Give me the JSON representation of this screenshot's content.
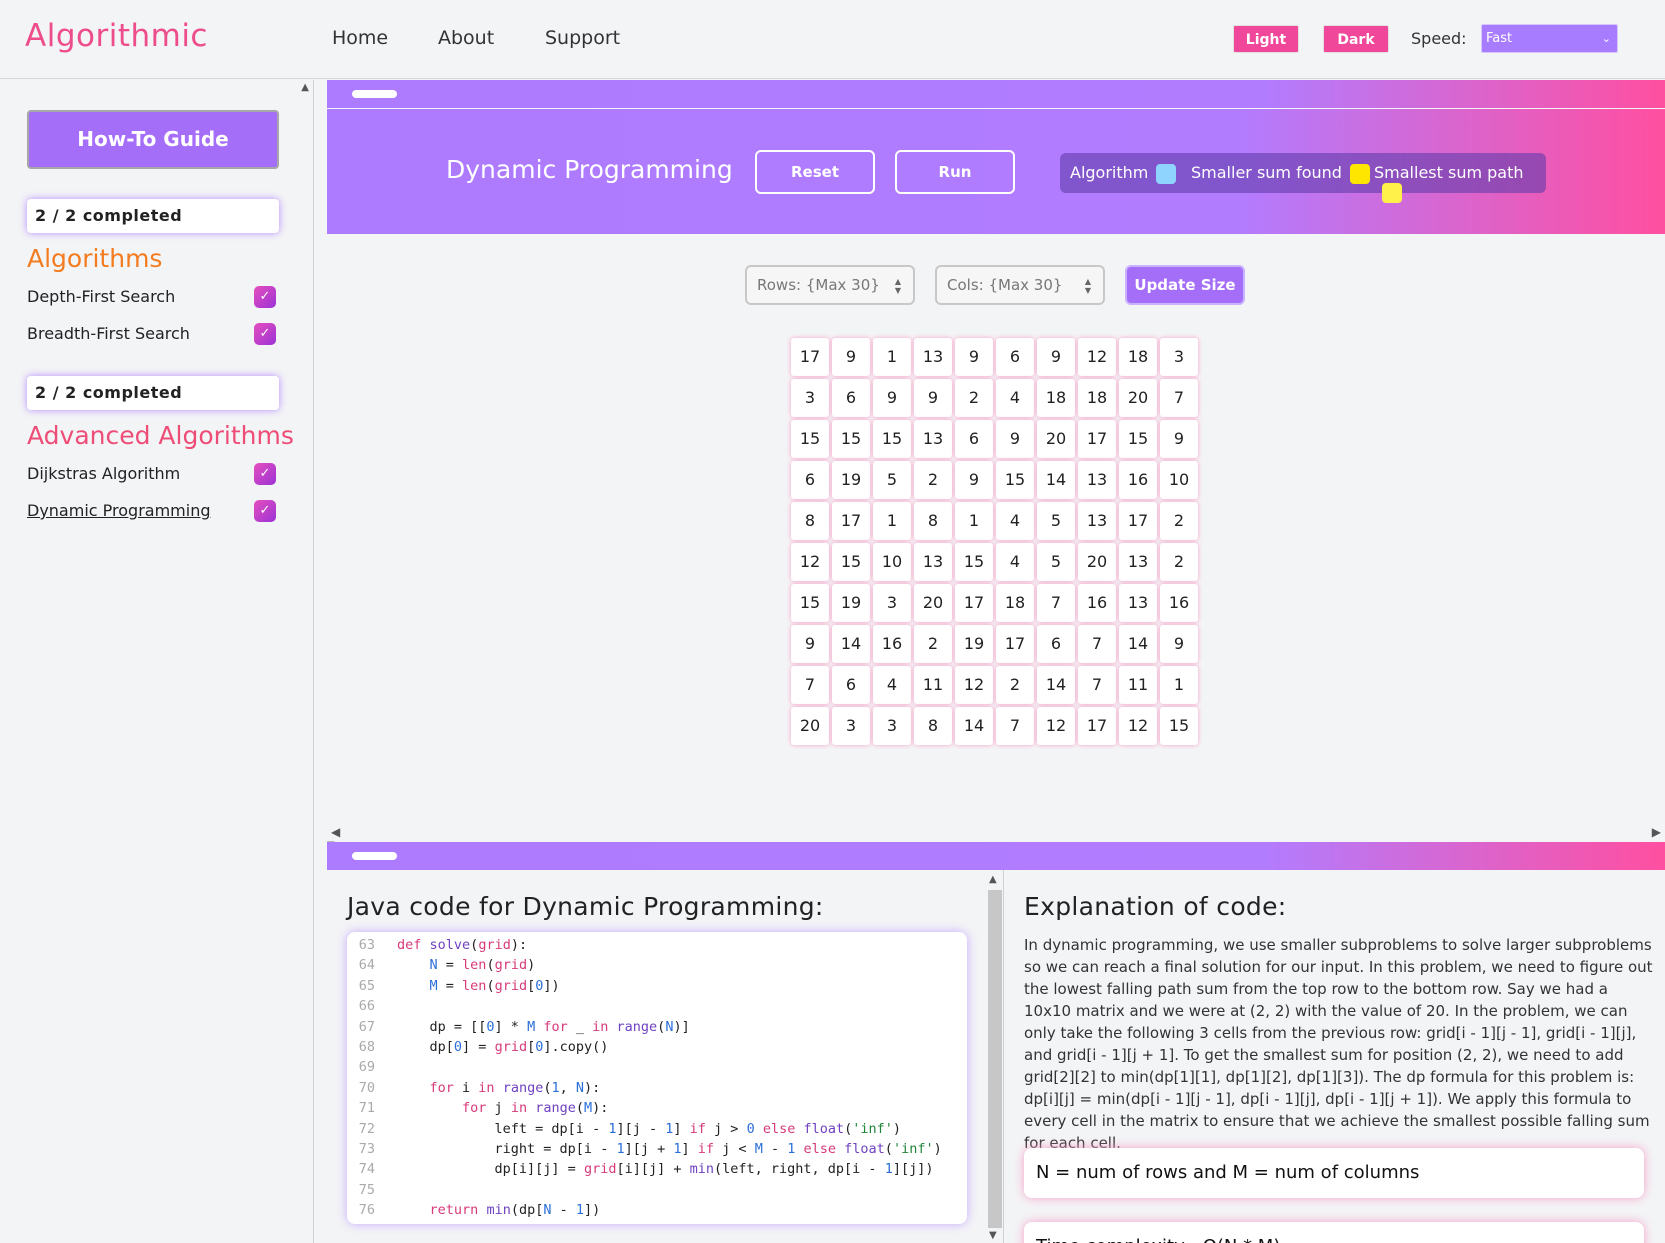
{
  "nav": {
    "brand": "Algorithmic",
    "links": [
      "Home",
      "About",
      "Support"
    ],
    "light_label": "Light",
    "dark_label": "Dark",
    "speed_label": "Speed:",
    "speed_value": "Fast"
  },
  "sidebar": {
    "howto_label": "How-To Guide",
    "sections": [
      {
        "progress": "2 / 2 completed",
        "title": "Algorithms",
        "title_color": "#f47c20",
        "items": [
          {
            "label": "Depth-First Search",
            "checked": true
          },
          {
            "label": "Breadth-First Search",
            "checked": true
          }
        ]
      },
      {
        "progress": "2 / 2 completed",
        "title": "Advanced Algorithms",
        "title_color": "#ee4d78",
        "items": [
          {
            "label": "Dijkstras Algorithm",
            "checked": true
          },
          {
            "label": "Dynamic Programming",
            "checked": true
          }
        ]
      }
    ]
  },
  "main": {
    "title": "Dynamic Programming",
    "reset_label": "Reset",
    "run_label": "Run",
    "legend": [
      {
        "label": "Algorithm",
        "color": "#8fd3ff"
      },
      {
        "label": "Smaller sum found",
        "color": "#ffe600"
      },
      {
        "label": "Smallest sum path",
        "color": "#fff04a"
      }
    ],
    "rows_placeholder": "Rows: {Max 30}",
    "cols_placeholder": "Cols: {Max 30}",
    "update_label": "Update Size",
    "grid": [
      [
        17,
        9,
        1,
        13,
        9,
        6,
        9,
        12,
        18,
        3
      ],
      [
        3,
        6,
        9,
        9,
        2,
        4,
        18,
        18,
        20,
        7
      ],
      [
        15,
        15,
        15,
        13,
        6,
        9,
        20,
        17,
        15,
        9
      ],
      [
        6,
        19,
        5,
        2,
        9,
        15,
        14,
        13,
        16,
        10
      ],
      [
        8,
        17,
        1,
        8,
        1,
        4,
        5,
        13,
        17,
        2
      ],
      [
        12,
        15,
        10,
        13,
        15,
        4,
        5,
        20,
        13,
        2
      ],
      [
        15,
        19,
        3,
        20,
        17,
        18,
        7,
        16,
        13,
        16
      ],
      [
        9,
        14,
        16,
        2,
        19,
        17,
        6,
        7,
        14,
        9
      ],
      [
        7,
        6,
        4,
        11,
        12,
        2,
        14,
        7,
        11,
        1
      ],
      [
        20,
        3,
        3,
        8,
        14,
        7,
        12,
        17,
        12,
        15
      ]
    ]
  },
  "code": {
    "title": "Java code for Dynamic Programming:",
    "lines": [
      {
        "n": "63",
        "html": "<span class=\"kw\">def</span> <span class=\"fn\">solve</span>(<span class=\"kw\">grid</span>):"
      },
      {
        "n": "64",
        "html": "    <span class=\"nm\">N</span> = <span class=\"kw\">len</span>(<span class=\"kw\">grid</span>)"
      },
      {
        "n": "65",
        "html": "    <span class=\"nm\">M</span> = <span class=\"kw\">len</span>(<span class=\"kw\">grid</span>[<span class=\"nm\">0</span>])"
      },
      {
        "n": "66",
        "html": ""
      },
      {
        "n": "67",
        "html": "    dp = [[<span class=\"nm\">0</span>] * <span class=\"nm\">M</span> <span class=\"kw\">for</span> _ <span class=\"kw\">in</span> <span class=\"fn\">range</span>(<span class=\"nm\">N</span>)]"
      },
      {
        "n": "68",
        "html": "    dp[<span class=\"nm\">0</span>] = <span class=\"kw\">grid</span>[<span class=\"nm\">0</span>].copy()"
      },
      {
        "n": "69",
        "html": ""
      },
      {
        "n": "70",
        "html": "    <span class=\"kw\">for</span> i <span class=\"kw\">in</span> <span class=\"fn\">range</span>(<span class=\"nm\">1</span>, <span class=\"nm\">N</span>):"
      },
      {
        "n": "71",
        "html": "        <span class=\"kw\">for</span> j <span class=\"kw\">in</span> <span class=\"fn\">range</span>(<span class=\"nm\">M</span>):"
      },
      {
        "n": "72",
        "html": "            left = dp[i - <span class=\"nm\">1</span>][j - <span class=\"nm\">1</span>] <span class=\"kw\">if</span> j > <span class=\"nm\">0</span> <span class=\"kw\">else</span> <span class=\"fn\">float</span>(<span class=\"st\">'inf'</span>)"
      },
      {
        "n": "73",
        "html": "            right = dp[i - <span class=\"nm\">1</span>][j + <span class=\"nm\">1</span>] <span class=\"kw\">if</span> j < <span class=\"nm\">M</span> - <span class=\"nm\">1</span> <span class=\"kw\">else</span> <span class=\"fn\">float</span>(<span class=\"st\">'inf'</span>)"
      },
      {
        "n": "74",
        "html": "            dp[i][j] = <span class=\"kw\">grid</span>[i][j] + <span class=\"fn\">min</span>(left, right, dp[i - <span class=\"nm\">1</span>][j])"
      },
      {
        "n": "75",
        "html": ""
      },
      {
        "n": "76",
        "html": "    <span class=\"kw\">return</span> <span class=\"fn\">min</span>(dp[<span class=\"nm\">N</span> - <span class=\"nm\">1</span>])"
      }
    ]
  },
  "explanation": {
    "title": "Explanation of code:",
    "text": "In dynamic programming, we use smaller subproblems to solve larger subproblems so we can reach a final solution for our input. In this problem, we need to figure out the lowest falling path sum from the top row to the bottom row. Say we had a 10x10 matrix and we were at (2, 2) with the value of 20. In the problem, we can only take the following 3 cells from the previous row: grid[i - 1][j - 1], grid[i - 1][j], and grid[i - 1][j + 1]. To get the smallest sum for position (2, 2), we need to add grid[2][2] to min(dp[1][1], dp[1][2], dp[1][3]). The dp formula for this problem is: dp[i][j] = min(dp[i - 1][j - 1], dp[i - 1][j], dp[i - 1][j + 1]). We apply this formula to every cell in the matrix to ensure that we achieve the smallest possible falling sum for each cell.",
    "card1": "N = num of rows and M = num of columns",
    "card2": "Time complexity - O(N * M)"
  }
}
